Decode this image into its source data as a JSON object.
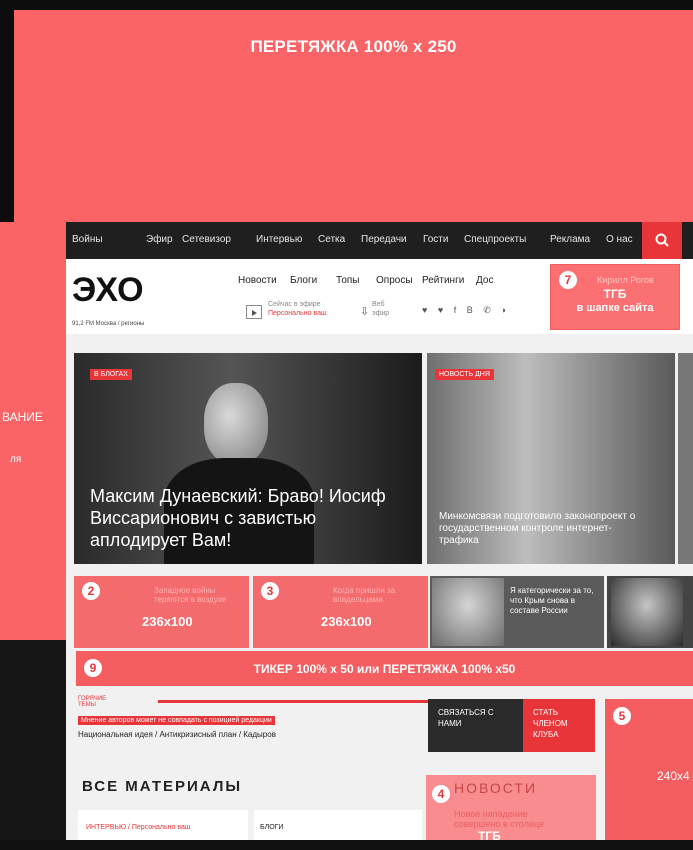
{
  "banner": {
    "label": "ПЕРЕТЯЖКА 100% x 250"
  },
  "side_ad": {
    "line1": "ВАНИЕ",
    "line2": "ля"
  },
  "topnav": {
    "items": [
      "Войны",
      "Эфир",
      "Сетевизор",
      "Интервью",
      "Сетка",
      "Передачи",
      "Гости",
      "Спецпроекты",
      "Реклама",
      "О нас"
    ]
  },
  "header": {
    "logo": "ЭХО",
    "logo_sub": "91,2 FM Москва / регионы",
    "subnav": [
      "Новости",
      "Блоги",
      "Топы",
      "Опросы",
      "Рейтинги",
      "Дос"
    ],
    "on_air": "Сейчас в эфире",
    "on_air_show": "Персонально ваш",
    "web": "Веб",
    "web_sub": "эфир",
    "social": "♥ ♥ f B ✆ ◗"
  },
  "tgb_top": {
    "badge": "7",
    "name": "Кирилл Рогов",
    "label1": "ТГБ",
    "label2": "в шапке сайта"
  },
  "main_story": {
    "tag": "В БЛОГАХ",
    "headline": "Максим Дунаевский: Браво! Иосиф Виссарионович с завистью аплодирует Вам!"
  },
  "second_story": {
    "tag": "НОВОСТЬ ДНЯ",
    "headline": "Минкомсвязи подготовило законопроект о государственном контроле интернет-трафика"
  },
  "tiles": [
    {
      "badge": "2",
      "label": "236x100",
      "faded": "Западное войны теряются в воздухе"
    },
    {
      "badge": "3",
      "label": "236x100",
      "faded": "Когда пришли за владельцами"
    },
    {
      "text": "Я категорически за то, что Крым снова в составе России"
    },
    {
      "text": ""
    }
  ],
  "ticker": {
    "badge": "9",
    "label": "ТИКЕР 100% x 50 или ПЕРЕТЯЖКА 100% x50"
  },
  "hot_topics": {
    "label": "ГОРЯЧИЕ ТЕМЫ",
    "disclaimer": "Мнение авторов может не совпадать с позицией редакции",
    "links": "Национальная идея / Антикризисный план / Кадыров"
  },
  "contact": {
    "label": "СВЯЗАТЬСЯ С НАМИ"
  },
  "join": {
    "label": "СТАТЬ ЧЛЕНОМ КЛУБА"
  },
  "box5": {
    "badge": "5",
    "label": "240x4"
  },
  "all_materials": {
    "title": "ВСЕ МАТЕРИАЛЫ"
  },
  "news_box": {
    "badge": "4",
    "title": "НОВОСТИ",
    "headline": "Новое нападение совершено в столице",
    "label": "ТГБ"
  },
  "cards": {
    "card1": "ИНТЕРВЬЮ / Персонально ваш",
    "card2": "БЛОГИ"
  },
  "colors": {
    "ad_red": "#fb6466",
    "brand_red": "#e8353a",
    "dark": "#1f1f1f"
  }
}
